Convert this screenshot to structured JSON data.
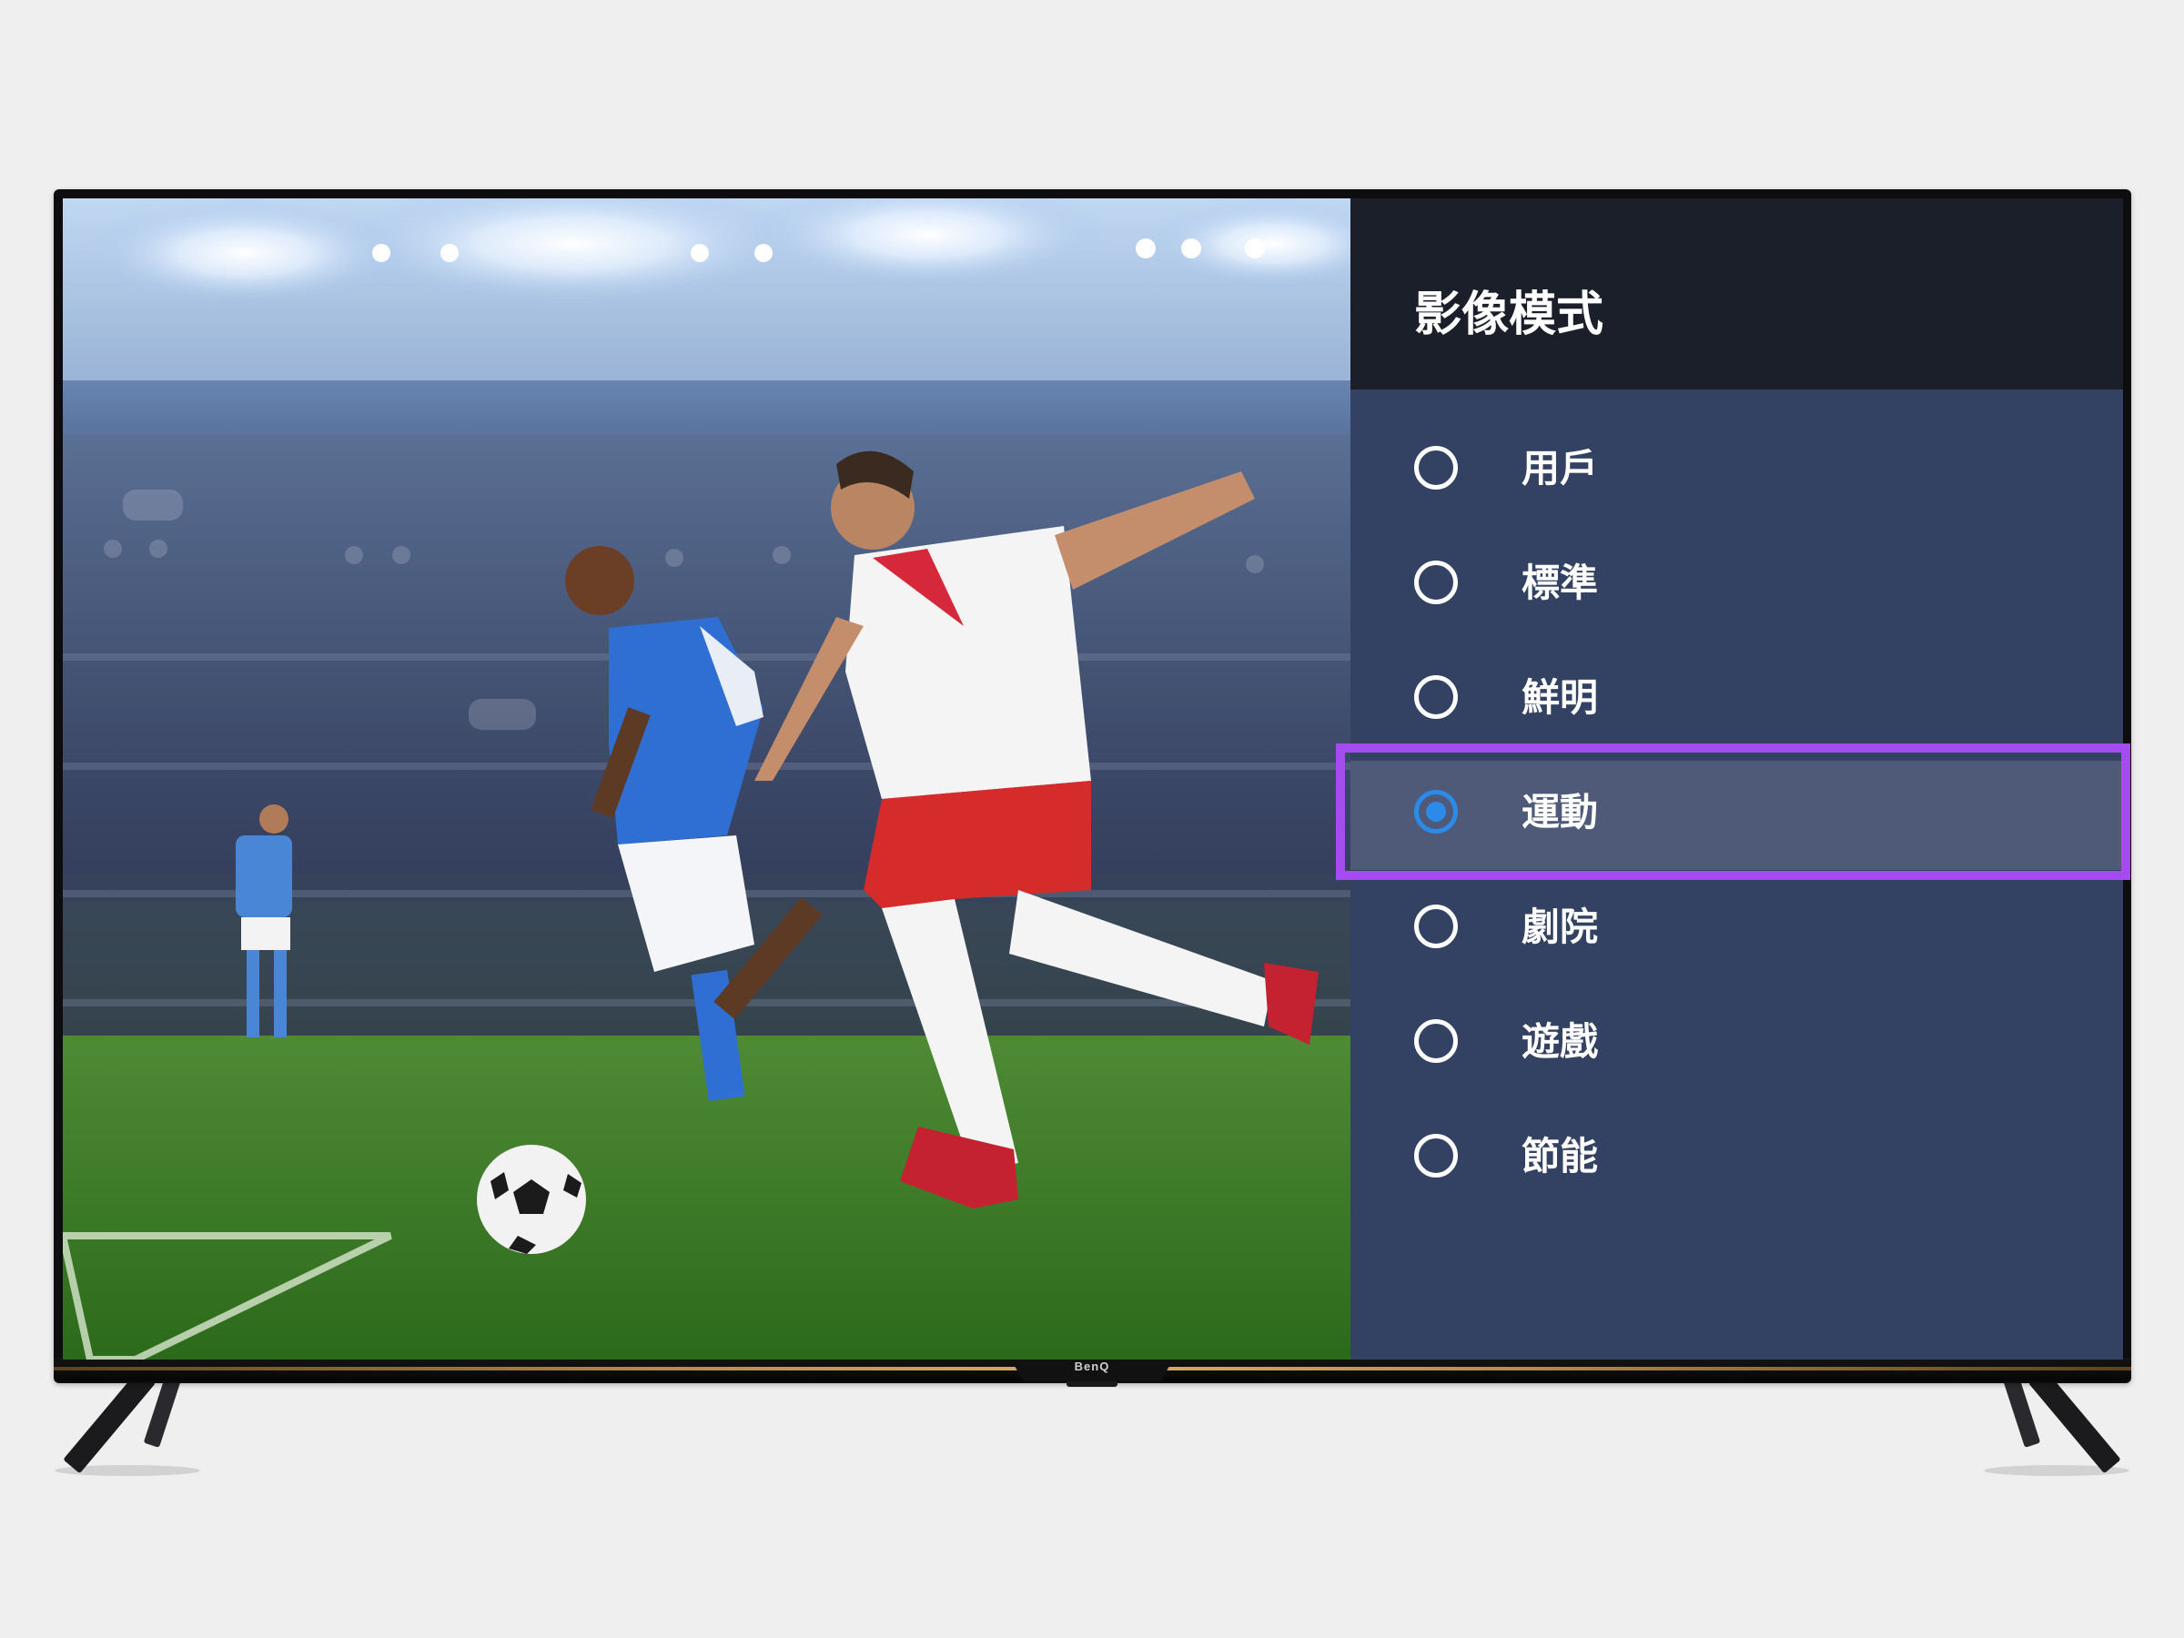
{
  "tv": {
    "brand": "BenQ"
  },
  "menu": {
    "title": "影像模式",
    "selected_index": 3,
    "items": [
      {
        "label": "用戶",
        "selected": false
      },
      {
        "label": "標準",
        "selected": false
      },
      {
        "label": "鮮明",
        "selected": false
      },
      {
        "label": "運動",
        "selected": true
      },
      {
        "label": "劇院",
        "selected": false
      },
      {
        "label": "遊戲",
        "selected": false
      },
      {
        "label": "節能",
        "selected": false
      }
    ]
  },
  "colors": {
    "panel_background": "#334263",
    "header_background": "#1b1f2a",
    "selected_row": "#4e5a78",
    "radio_selected": "#2c8be8",
    "focus_highlight": "#a54cf0"
  },
  "icons": {
    "radio_empty": "radio-unchecked-icon",
    "radio_selected": "radio-checked-icon"
  }
}
